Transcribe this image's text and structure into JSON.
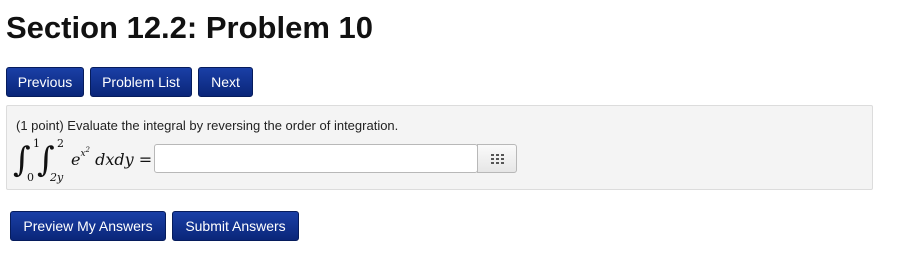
{
  "page": {
    "title": "Section 12.2: Problem 10"
  },
  "nav": {
    "previous_label": "Previous",
    "problem_list_label": "Problem List",
    "next_label": "Next"
  },
  "problem": {
    "text": "(1 point) Evaluate the integral by reversing the order of integration.",
    "math": {
      "outer_upper": "1",
      "outer_lower": "0",
      "inner_upper": "2",
      "inner_lower": "2y",
      "integrand_base": "e",
      "integrand_exp_base": "x",
      "integrand_exp_power": "2",
      "differentials": " dxdy ",
      "equals": "="
    },
    "answer": {
      "value": "",
      "placeholder": ""
    },
    "keypad_icon": "grid-icon"
  },
  "actions": {
    "preview_label": "Preview My Answers",
    "submit_label": "Submit Answers"
  },
  "colors": {
    "button_bg": "#0d2f8e",
    "box_bg": "#f4f4f4"
  }
}
